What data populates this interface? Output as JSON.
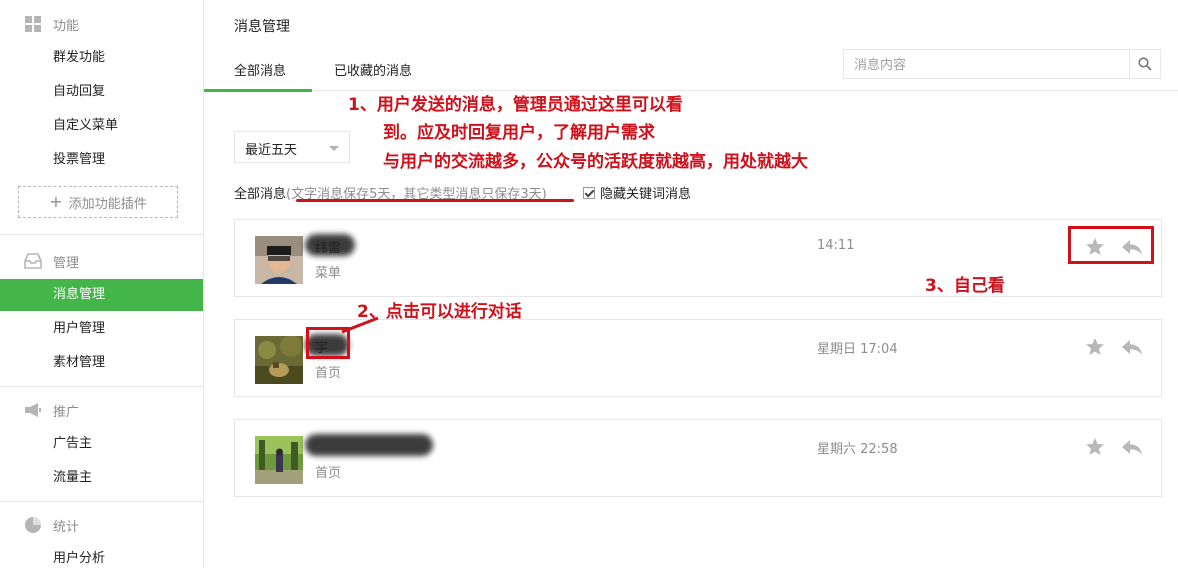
{
  "sidebar": {
    "sections": [
      {
        "title": "功能",
        "icon": "grid-icon",
        "items": [
          "群发功能",
          "自动回复",
          "自定义菜单",
          "投票管理"
        ]
      },
      {
        "title": "管理",
        "icon": "inbox-icon",
        "items": [
          "消息管理",
          "用户管理",
          "素材管理"
        ]
      },
      {
        "title": "推广",
        "icon": "megaphone-icon",
        "items": [
          "广告主",
          "流量主"
        ]
      },
      {
        "title": "统计",
        "icon": "pie-chart-icon",
        "items": [
          "用户分析"
        ]
      }
    ],
    "add_plugin_label": "添加功能插件",
    "active_item": "消息管理"
  },
  "main": {
    "page_title": "消息管理",
    "tabs": [
      {
        "label": "全部消息",
        "active": true
      },
      {
        "label": "已收藏的消息",
        "active": false
      }
    ],
    "search": {
      "placeholder": "消息内容",
      "value": ""
    },
    "date_filter": {
      "selected": "最近五天"
    },
    "filter_label": "全部消息",
    "filter_note": "(文字消息保存5天，其它类型消息只保存3天)",
    "hide_keyword": {
      "label": "隐藏关键词消息",
      "checked": true
    }
  },
  "messages": [
    {
      "name": "纬雷",
      "source": "菜单",
      "time": "14:11"
    },
    {
      "name": "宇",
      "source": "首页",
      "time": "星期日 17:04"
    },
    {
      "name": "",
      "source": "首页",
      "time": "星期六 22:58"
    }
  ],
  "annotations": {
    "note1_line1": "1、用户发送的消息，管理员通过这里可以看",
    "note1_line2": "到。应及时回复用户，了解用户需求",
    "note1_line3": "与用户的交流越多，公众号的活跃度就越高，用处就越大",
    "note2": "2、点击可以进行对话",
    "note3": "3、自己看"
  },
  "colors": {
    "accent": "#44b549",
    "annotation": "#d0101a",
    "muted_text": "#8d8d8d",
    "border": "#e7e7eb"
  }
}
